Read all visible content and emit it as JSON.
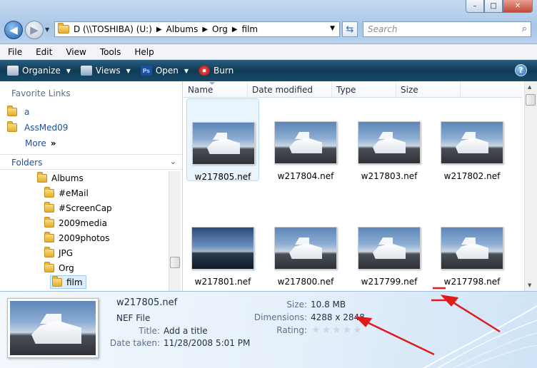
{
  "window": {
    "controls": {
      "minimize": "–",
      "maximize": "□",
      "close": "✕"
    }
  },
  "nav": {
    "back_icon": "back-arrow-icon",
    "forward_icon": "forward-arrow-icon"
  },
  "address": {
    "crumbs": [
      "D (\\\\TOSHIBA) (U:)",
      "Albums",
      "Org",
      "film"
    ],
    "lead": "«"
  },
  "search": {
    "placeholder": "Search"
  },
  "menu": {
    "items": [
      "File",
      "Edit",
      "View",
      "Tools",
      "Help"
    ]
  },
  "toolbar": {
    "organize": "Organize",
    "views": "Views",
    "open": "Open",
    "burn": "Burn",
    "help": "?"
  },
  "sidebar": {
    "favorites_title": "Favorite Links",
    "favorites": [
      "a",
      "AssMed09"
    ],
    "more": "More",
    "folders_title": "Folders",
    "tree": [
      {
        "label": "Albums",
        "level": 0
      },
      {
        "label": "#eMail",
        "level": 1
      },
      {
        "label": "#ScreenCap",
        "level": 1
      },
      {
        "label": "2009media",
        "level": 1
      },
      {
        "label": "2009photos",
        "level": 1
      },
      {
        "label": "JPG",
        "level": 1
      },
      {
        "label": "Org",
        "level": 1
      },
      {
        "label": "film",
        "level": 2,
        "selected": true
      }
    ]
  },
  "columns": [
    "Name",
    "Date modified",
    "Type",
    "Size"
  ],
  "files": [
    {
      "name": "w217805.nef",
      "selected": true
    },
    {
      "name": "w217804.nef"
    },
    {
      "name": "w217803.nef"
    },
    {
      "name": "w217802.nef"
    },
    {
      "name": "w217801.nef",
      "dark": true
    },
    {
      "name": "w217800.nef"
    },
    {
      "name": "w217799.nef"
    },
    {
      "name": "w217798.nef"
    }
  ],
  "details": {
    "name": "w217805.nef",
    "type": "NEF File",
    "title_label": "Title:",
    "title_value": "Add a title",
    "date_label": "Date taken:",
    "date_value": "11/28/2008 5:01 PM",
    "size_label": "Size:",
    "size_value": "10.8 MB",
    "dimensions_label": "Dimensions:",
    "dimensions_value": "4288 x 2848",
    "rating_label": "Rating:",
    "rating_stars": 5
  },
  "colors": {
    "annotation_arrow": "#e01b1b",
    "toolbar": "#1a4a66",
    "link": "#1b4fa0"
  }
}
